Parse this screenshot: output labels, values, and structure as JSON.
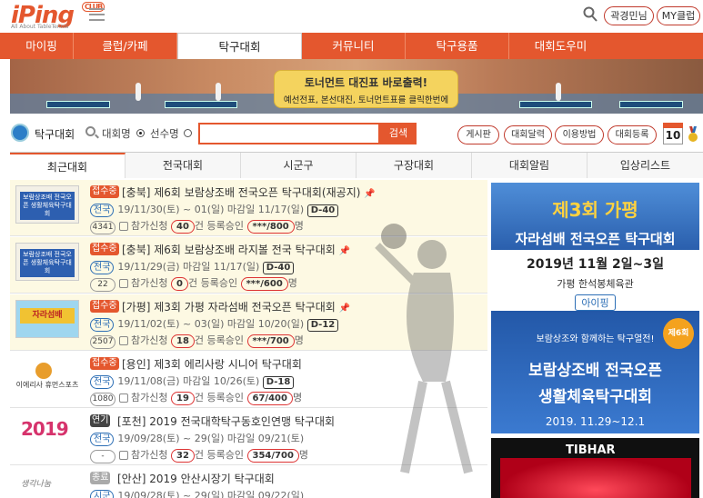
{
  "header": {
    "logo": "iPing",
    "logo_club": "CLUB",
    "logo_sub": "All About TableTennis",
    "btn_manager": "곽경민님",
    "btn_myclub": "MY클럽"
  },
  "nav": [
    "마이핑",
    "클럽/카페",
    "탁구대회",
    "커뮤니티",
    "탁구용품",
    "대회도우미"
  ],
  "nav_active": "탁구대회",
  "banner": {
    "line1": "토너먼트 대진표 바로출력!",
    "line2": "예선전표, 본선대진, 토너먼트표를 클릭한번에"
  },
  "search": {
    "title": "탁구대회",
    "opt1": "대회명",
    "opt2": "선수명",
    "placeholder": "",
    "button": "검색",
    "pills": [
      "게시판",
      "대회달력",
      "이용방법",
      "대회등록"
    ],
    "calendar_day": "10"
  },
  "tabs": [
    "최근대회",
    "전국대회",
    "시군구",
    "구장대회",
    "대회알림",
    "입상리스트"
  ],
  "rows": [
    {
      "badge": "접수중",
      "title": "[충북] 제6회 보람상조배 전국오픈 탁구대회(재공지)",
      "scope": "전국",
      "dates": "19/11/30(토) ~ 01(일) 마감일 11/17(일)",
      "dday": "D-40",
      "views": "4341",
      "apply": "참가신청",
      "apply_n": "40",
      "apply_unit": "건",
      "approve": "등록승인",
      "count": "***/800",
      "unit": "명",
      "thumb": "보람상조배 전국오픈 생활체육탁구대회"
    },
    {
      "badge": "접수중",
      "title": "[충북] 제6회 보람상조배 라지볼 전국 탁구대회",
      "scope": "전국",
      "dates": "19/11/29(금) 마감일 11/17(일)",
      "dday": "D-40",
      "views": "22",
      "apply": "참가신청",
      "apply_n": "0",
      "apply_unit": "건",
      "approve": "등록승인",
      "count": "***/600",
      "unit": "명",
      "thumb": "보람상조배 전국오픈 생활체육탁구대회"
    },
    {
      "badge": "접수중",
      "title": "[가평] 제3회 가평 자라섬배 전국오픈 탁구대회",
      "scope": "전국",
      "dates": "19/11/02(토) ~ 03(일) 마감일 10/20(일)",
      "dday": "D-12",
      "views": "2507",
      "apply": "참가신청",
      "apply_n": "18",
      "apply_unit": "건",
      "approve": "등록승인",
      "count": "***/700",
      "unit": "명",
      "thumb": "자라섬배"
    },
    {
      "badge": "접수중",
      "title": "[용인] 제3회 에리사랑 시니어 탁구대회",
      "scope": "전국",
      "dates": "19/11/08(금) 마감일 10/26(토)",
      "dday": "D-18",
      "views": "1080",
      "apply": "참가신청",
      "apply_n": "19",
      "apply_unit": "건",
      "approve": "등록승인",
      "count": "67/400",
      "unit": "명",
      "thumb": "이에리사 휴먼스포츠"
    },
    {
      "badge": "연기",
      "title": "[포천] 2019 전국대학탁구동호인연맹 탁구대회",
      "scope": "전국",
      "dates": "19/09/28(토) ~ 29(일) 마감일 09/21(토)",
      "dday": "",
      "views": "-",
      "apply": "참가신청",
      "apply_n": "32",
      "apply_unit": "건",
      "approve": "등록승인",
      "count": "354/700",
      "unit": "명",
      "thumb": "2019"
    },
    {
      "badge": "종료",
      "title": "[안산] 2019 안산시장기 탁구대회",
      "scope": "시군",
      "dates": "19/09/28(토) ~ 29(일) 마감일 09/22(일)",
      "dday": "",
      "views": "",
      "apply": "",
      "apply_n": "",
      "apply_unit": "",
      "approve": "",
      "count": "",
      "unit": "",
      "thumb": "생각나눔"
    }
  ],
  "ads": {
    "ad1": {
      "l1": "제3회 가평",
      "l2": "자라섬배 전국오픈 탁구대회",
      "l3": "2019년 11월 2일~3일",
      "l4": "가평 한석봉체육관",
      "l5": "아이핑"
    },
    "ad2": {
      "l1": "보람상조와 함께하는 탁구열전!",
      "badge": "제6회",
      "l2": "보람상조배 전국오픈",
      "l3": "생활체육탁구대회",
      "l4": "2019. 11.29~12.1"
    },
    "ad3": {
      "brand": "TIBHAR"
    }
  },
  "colors": {
    "accent": "#e4572e",
    "blue": "#2c6eb5"
  }
}
